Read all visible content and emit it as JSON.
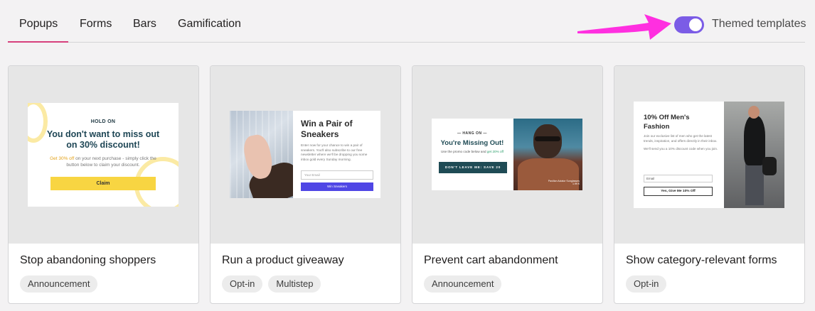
{
  "tabs": [
    {
      "label": "Popups",
      "active": true
    },
    {
      "label": "Forms",
      "active": false
    },
    {
      "label": "Bars",
      "active": false
    },
    {
      "label": "Gamification",
      "active": false
    }
  ],
  "toggle": {
    "label": "Themed templates",
    "on": true,
    "color": "#7b5ce6"
  },
  "annotation": {
    "icon": "arrow-right-icon",
    "color": "#ff2fe0"
  },
  "accent_color": "#d6407c",
  "cards": [
    {
      "title": "Stop abandoning shoppers",
      "tags": [
        "Announcement"
      ],
      "preview": {
        "kicker": "HOLD ON",
        "headline": "You don't want to miss out on 30% discount!",
        "body_highlight": "Get 30% off",
        "body": " on your next purchase - simply click the button below to claim your discount.",
        "button": "Claim"
      }
    },
    {
      "title": "Run a product giveaway",
      "tags": [
        "Opt-in",
        "Multistep"
      ],
      "preview": {
        "headline": "Win a Pair of Sneakers",
        "body": "Enter now for your chance to win a pair of sneakers. You'll also subscribe to our free newsletter where we'll be dropping you some inbox gold every Sunday morning.",
        "input_placeholder": "Your Email",
        "button": "Win Sneakers"
      }
    },
    {
      "title": "Prevent cart abandonment",
      "tags": [
        "Announcement"
      ],
      "preview": {
        "kicker": "— HANG ON —",
        "headline": "You're Missing Out!",
        "subtext": "Use the promo code below and ",
        "subtext_highlight": "get 20% off",
        "button": "DON'T LEAVE ME: SAVE 20",
        "caption": "Pavilion Aviator Sunglasses 1.99 €"
      }
    },
    {
      "title": "Show category-relevant forms",
      "tags": [
        "Opt-in"
      ],
      "preview": {
        "headline": "10% Off Men's Fashion",
        "body": "Join our exclusive list of men who get the latest trends, inspiration, and offers directly in their inbox.",
        "body2": "We'll send you a 10% discount code when you join.",
        "input_placeholder": "Email",
        "button": "Yes, Give Me 10% Off"
      }
    }
  ]
}
